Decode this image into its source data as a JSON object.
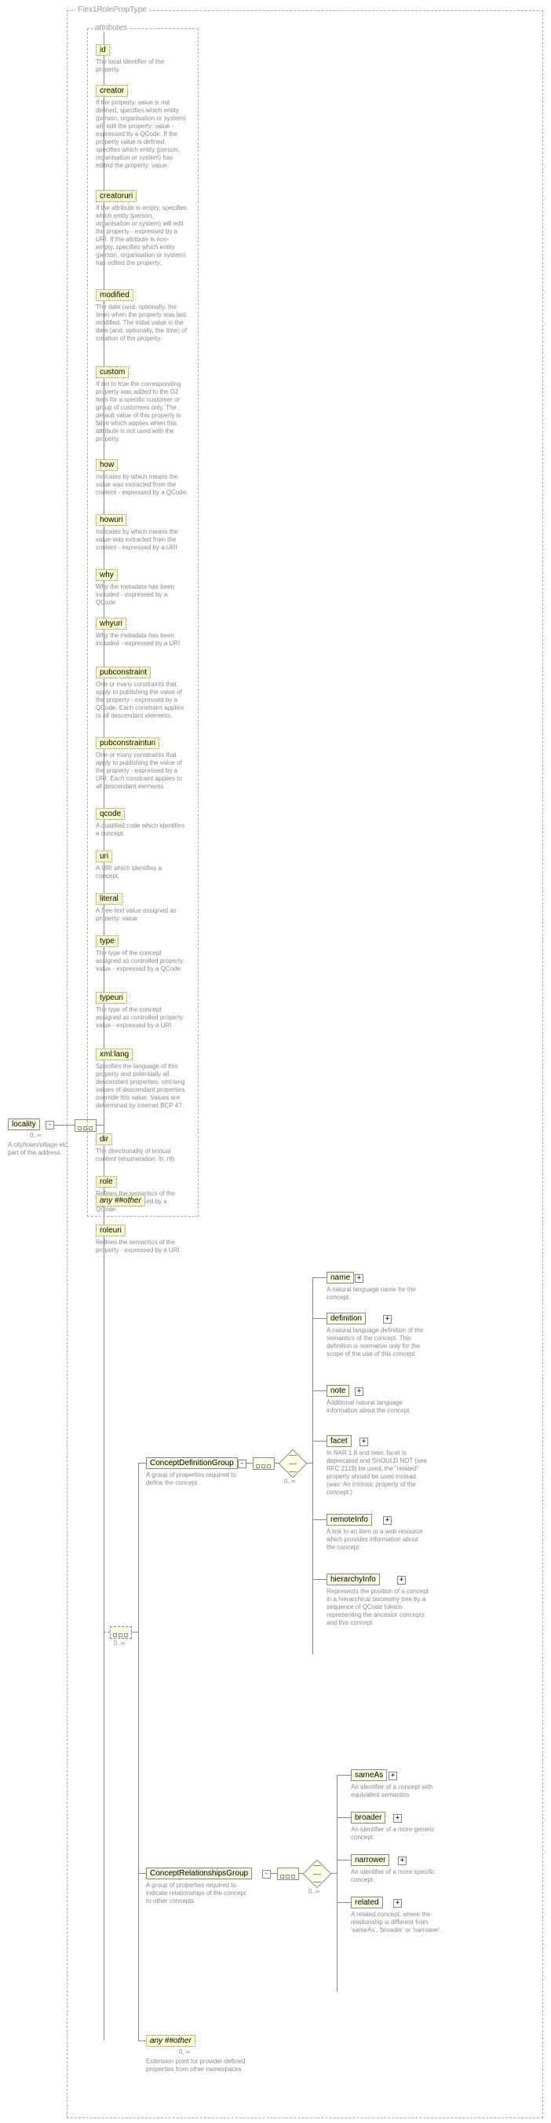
{
  "root": {
    "name": "locality",
    "occ": "0..∞",
    "desc": "A city/town/village etc. part of the address."
  },
  "typeLabel": "Flex1RolePropType",
  "attrHeader": "attributes",
  "attrs": [
    {
      "k": "id",
      "n": "id",
      "d": "The local identifier of the property."
    },
    {
      "k": "creator",
      "n": "creator",
      "d": "If the property: value is not defined, specifies which entity (person, organisation or system) will edit the property: value - expressed by a QCode. If the property value is defined, specifies which entity (person, organisation or system) has edited the property: value."
    },
    {
      "k": "creatoruri",
      "n": "creatoruri",
      "d": "If the attribute is empty, specifies which entity (person, organisation or system) will edit the property - expressed by a URI. If the attribute is non-empty, specifies which entity (person, organisation or system) has edited the property."
    },
    {
      "k": "modified",
      "n": "modified",
      "d": "The date (and, optionally, the time) when the property was last modified. The initial value is the date (and, optionally, the time) of creation of the property."
    },
    {
      "k": "custom",
      "n": "custom",
      "d": "If set to true the corresponding property was added to the G2 Item for a specific customer or group of customers only. The default value of this property is false which applies when this attribute is not used with the property."
    },
    {
      "k": "how",
      "n": "how",
      "d": "Indicates by which means the value was extracted from the content - expressed by a QCode"
    },
    {
      "k": "howuri",
      "n": "howuri",
      "d": "Indicates by which means the value was extracted from the content - expressed by a URI"
    },
    {
      "k": "why",
      "n": "why",
      "d": "Why the metadata has been included - expressed by a QCode"
    },
    {
      "k": "whyuri",
      "n": "whyuri",
      "d": "Why the metadata has been included - expressed by a URI"
    },
    {
      "k": "pubconstraint",
      "n": "pubconstraint",
      "d": "One or many constraints that apply to publishing the value of the property - expressed by a QCode. Each constraint applies to all descendant elements."
    },
    {
      "k": "pubconstrainturi",
      "n": "pubconstrainturi",
      "d": "One or many constraints that apply to publishing the value of the property - expressed by a URI. Each constraint applies to all descendant elements."
    },
    {
      "k": "qcode",
      "n": "qcode",
      "d": "A qualified code which identifies a concept."
    },
    {
      "k": "uri",
      "n": "uri",
      "d": "A URI which identifies a concept."
    },
    {
      "k": "literal",
      "n": "literal",
      "d": "A free-text value assigned as property: value."
    },
    {
      "k": "type",
      "n": "type",
      "d": "The type of the concept assigned as controlled property: value - expressed by a QCode"
    },
    {
      "k": "typeuri",
      "n": "typeuri",
      "d": "The type of the concept assigned as controlled property: value - expressed by a URI"
    },
    {
      "k": "xmllang",
      "n": "xml:lang",
      "d": "Specifies the language of this property and potentially all descendant properties. xml:lang values of descendant properties override this value. Values are determined by Internet BCP 47."
    },
    {
      "k": "dir",
      "n": "dir",
      "d": "The directionality of textual content (enumeration: ltr, rtl)"
    },
    {
      "k": "role",
      "n": "role",
      "d": "Refines the semantics of the property - expressed by a QCode"
    },
    {
      "k": "roleuri",
      "n": "roleuri",
      "d": "Refines the semantics of the property - expressed by a URI"
    }
  ],
  "anyAttr": "any ##other",
  "seqOcc": "0..∞",
  "groups": {
    "defG": {
      "label": "ConceptDefinitionGroup",
      "desc": "A group of properties required to define the concept"
    },
    "relG": {
      "label": "ConceptRelationshipsGroup",
      "desc": "A group of properties required to indicate relationships of the concept to other concepts"
    }
  },
  "defChildren": [
    {
      "k": "cname",
      "n": "name",
      "d": "A natural language name for the concept."
    },
    {
      "k": "definition",
      "n": "definition",
      "d": "A natural language definition of the semantics of the concept. This definition is normative only for the scope of the use of this concept."
    },
    {
      "k": "cnote",
      "n": "note",
      "d": "Additional natural language information about the concept."
    },
    {
      "k": "facet",
      "n": "facet",
      "d": "In NAR 1.8 and later, facet is deprecated and SHOULD NOT (see RFC 2119) be used, the \"related\" property should be used instead.(was: An intrinsic property of the concept.)"
    },
    {
      "k": "remoteInfo",
      "n": "remoteInfo",
      "d": "A link to an item or a web resource which provides information about the concept"
    },
    {
      "k": "hierarchyInfo",
      "n": "hierarchyInfo",
      "d": "Represents the position of a concept in a hierarchical taxonomy tree by a sequence of QCode tokens representing the ancestor concepts and this concept"
    }
  ],
  "relChildren": [
    {
      "k": "sameAs",
      "n": "sameAs",
      "d": "An identifier of a concept with equivalent semantics"
    },
    {
      "k": "broader",
      "n": "broader",
      "d": "An identifier of a more generic concept."
    },
    {
      "k": "narrower",
      "n": "narrower",
      "d": "An identifier of a more specific concept."
    },
    {
      "k": "related",
      "n": "related",
      "d": "A related concept, where the relationship is different from 'sameAs', 'broader' or 'narrower'."
    }
  ],
  "anyOther": {
    "label": "any ##other",
    "occ": "0..∞",
    "desc": "Extension point for provider-defined properties from other namespaces"
  }
}
